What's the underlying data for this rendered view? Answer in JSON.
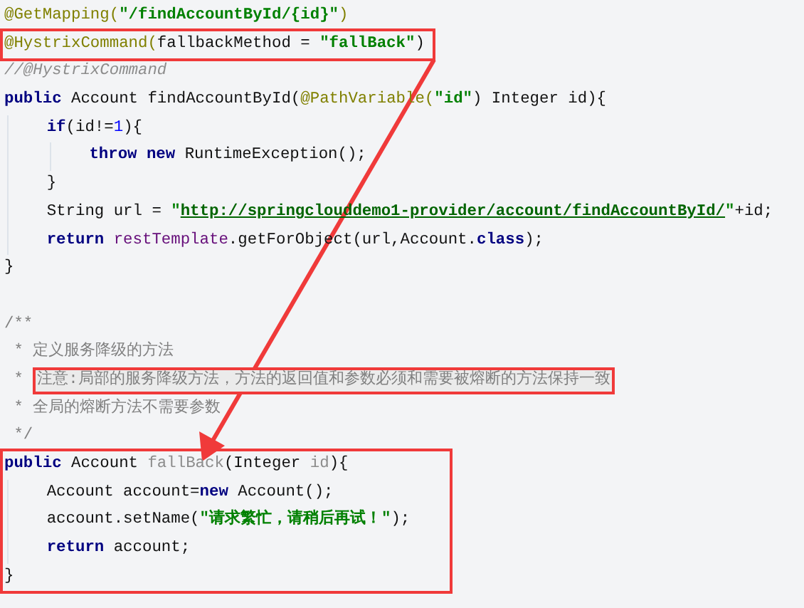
{
  "editor": {
    "sections": [
      {
        "blocks": [
          {
            "boxed": false,
            "lines": [
              {
                "tokens": [
                  {
                    "text": "@GetMapping(",
                    "kind": "annotation"
                  },
                  {
                    "text": "\"/findAccountById/{id}\"",
                    "kind": "string"
                  },
                  {
                    "text": ")",
                    "kind": "annotation"
                  }
                ]
              }
            ]
          },
          {
            "boxed": true,
            "lines": [
              {
                "tokens": [
                  {
                    "text": "@HystrixCommand(",
                    "kind": "annotation"
                  },
                  {
                    "text": "fallbackMethod = ",
                    "kind": "plain"
                  },
                  {
                    "text": "\"fallBack\"",
                    "kind": "string"
                  },
                  {
                    "text": ")",
                    "kind": "plain"
                  }
                ]
              }
            ]
          },
          {
            "boxed": false,
            "lines": [
              {
                "tokens": [
                  {
                    "text": "//@HystrixCommand",
                    "kind": "comment"
                  }
                ]
              },
              {
                "tokens": [
                  {
                    "text": "public ",
                    "kind": "keyword"
                  },
                  {
                    "text": "Account findAccountById(",
                    "kind": "plain"
                  },
                  {
                    "text": "@PathVariable(",
                    "kind": "annotation"
                  },
                  {
                    "text": "\"id\"",
                    "kind": "string"
                  },
                  {
                    "text": ") Integer id){",
                    "kind": "plain"
                  }
                ],
                "children": [
                  {
                    "tokens": [
                      {
                        "text": "if",
                        "kind": "keyword"
                      },
                      {
                        "text": "(id!=",
                        "kind": "plain"
                      },
                      {
                        "text": "1",
                        "kind": "number"
                      },
                      {
                        "text": "){",
                        "kind": "plain"
                      }
                    ],
                    "children": [
                      {
                        "tokens": [
                          {
                            "text": "throw new ",
                            "kind": "keyword"
                          },
                          {
                            "text": "RuntimeException();",
                            "kind": "plain"
                          }
                        ]
                      }
                    ]
                  },
                  {
                    "tokens": [
                      {
                        "text": "}",
                        "kind": "plain"
                      }
                    ]
                  },
                  {
                    "tokens": [
                      {
                        "text": "String url = ",
                        "kind": "plain"
                      },
                      {
                        "text": "\"",
                        "kind": "string"
                      },
                      {
                        "text": "http://springclouddemo1-provider/account/findAccountById/",
                        "kind": "link"
                      },
                      {
                        "text": "\"",
                        "kind": "string"
                      },
                      {
                        "text": "+id;",
                        "kind": "plain"
                      }
                    ]
                  },
                  {
                    "tokens": [
                      {
                        "text": "return ",
                        "kind": "keyword"
                      },
                      {
                        "text": "restTemplate",
                        "kind": "field"
                      },
                      {
                        "text": ".getForObject(url,Account.",
                        "kind": "plain"
                      },
                      {
                        "text": "class",
                        "kind": "keyword"
                      },
                      {
                        "text": ");",
                        "kind": "plain"
                      }
                    ]
                  }
                ]
              },
              {
                "tokens": [
                  {
                    "text": "}",
                    "kind": "plain"
                  }
                ]
              }
            ]
          }
        ]
      },
      {
        "blocks": [
          {
            "boxed": false,
            "lines": [
              {
                "tokens": [
                  {
                    "text": "/**",
                    "kind": "doc"
                  }
                ]
              },
              {
                "tokens": [
                  {
                    "text": " * 定义服务降级的方法",
                    "kind": "doc"
                  }
                ]
              },
              {
                "tokens": [
                  {
                    "text": " * ",
                    "kind": "doc"
                  },
                  {
                    "text": "注意:局部的服务降级方法，方法的返回值和参数必须和需要被熔断的方法保持一致",
                    "kind": "doc",
                    "boxed": true
                  }
                ]
              },
              {
                "tokens": [
                  {
                    "text": " * 全局的熔断方法不需要参数",
                    "kind": "doc"
                  }
                ]
              },
              {
                "tokens": [
                  {
                    "text": " */",
                    "kind": "doc"
                  }
                ]
              }
            ]
          },
          {
            "boxed": true,
            "lines": [
              {
                "tokens": [
                  {
                    "text": "public ",
                    "kind": "keyword"
                  },
                  {
                    "text": "Account ",
                    "kind": "plain"
                  },
                  {
                    "text": "fallBack",
                    "kind": "unused"
                  },
                  {
                    "text": "(Integer ",
                    "kind": "plain"
                  },
                  {
                    "text": "id",
                    "kind": "unused"
                  },
                  {
                    "text": "){",
                    "kind": "plain"
                  }
                ],
                "children": [
                  {
                    "tokens": [
                      {
                        "text": "Account account=",
                        "kind": "plain"
                      },
                      {
                        "text": "new ",
                        "kind": "keyword"
                      },
                      {
                        "text": "Account();",
                        "kind": "plain"
                      }
                    ]
                  },
                  {
                    "tokens": [
                      {
                        "text": "account.setName(",
                        "kind": "plain"
                      },
                      {
                        "text": "\"请求繁忙，请稍后再试！\"",
                        "kind": "string"
                      },
                      {
                        "text": ");",
                        "kind": "plain"
                      }
                    ]
                  },
                  {
                    "tokens": [
                      {
                        "text": "return ",
                        "kind": "keyword"
                      },
                      {
                        "text": "account;",
                        "kind": "plain"
                      }
                    ]
                  }
                ]
              },
              {
                "tokens": [
                  {
                    "text": "}",
                    "kind": "plain"
                  }
                ]
              }
            ]
          }
        ]
      }
    ]
  }
}
